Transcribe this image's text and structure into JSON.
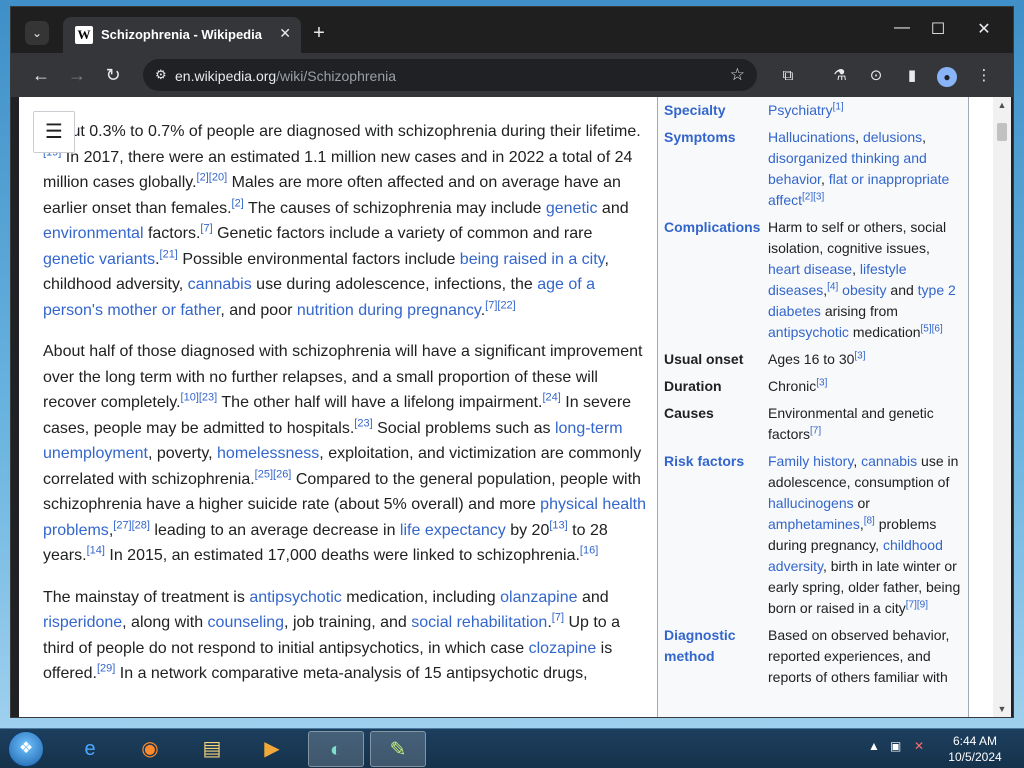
{
  "browser": {
    "tab_title": "Schizophrenia - Wikipedia",
    "favicon": "W",
    "url_host": "en.wikipedia.org",
    "url_path": "/wiki/Schizophrenia"
  },
  "article": {
    "p1": [
      {
        "t": "About 0.3% to 0.7% of people are diagnosed with schizophrenia during their lifetime."
      },
      {
        "s": "[19]"
      },
      {
        "t": " In 2017, there were an estimated 1.1 million new cases and in 2022 a total of 24 million cases globally."
      },
      {
        "s": "[2][20]"
      },
      {
        "t": " Males are more often affected and on average have an earlier onset than females."
      },
      {
        "s": "[2]"
      },
      {
        "t": " The causes of schizophrenia may include "
      },
      {
        "a": "genetic"
      },
      {
        "t": " and "
      },
      {
        "a": "environmental"
      },
      {
        "t": " factors."
      },
      {
        "s": "[7]"
      },
      {
        "t": " Genetic factors include a variety of common and rare "
      },
      {
        "a": "genetic variants"
      },
      {
        "t": "."
      },
      {
        "s": "[21]"
      },
      {
        "t": " Possible environmental factors include "
      },
      {
        "a": "being raised in a city"
      },
      {
        "t": ", childhood adversity, "
      },
      {
        "a": "cannabis"
      },
      {
        "t": " use during adolescence, infections, the "
      },
      {
        "a": "age of a person's mother or father"
      },
      {
        "t": ", and poor "
      },
      {
        "a": "nutrition during pregnancy"
      },
      {
        "t": "."
      },
      {
        "s": "[7][22]"
      }
    ],
    "p2": [
      {
        "t": "About half of those diagnosed with schizophrenia will have a significant improvement over the long term with no further relapses, and a small proportion of these will recover completely."
      },
      {
        "s": "[10][23]"
      },
      {
        "t": " The other half will have a lifelong impairment."
      },
      {
        "s": "[24]"
      },
      {
        "t": " In severe cases, people may be admitted to hospitals."
      },
      {
        "s": "[23]"
      },
      {
        "t": " Social problems such as "
      },
      {
        "a": "long-term unemployment"
      },
      {
        "t": ", poverty, "
      },
      {
        "a": "homelessness"
      },
      {
        "t": ", exploitation, and victimization are commonly correlated with schizophrenia."
      },
      {
        "s": "[25][26]"
      },
      {
        "t": " Compared to the general population, people with schizophrenia have a higher suicide rate (about 5% overall) and more "
      },
      {
        "a": "physical health problems"
      },
      {
        "t": ","
      },
      {
        "s": "[27][28]"
      },
      {
        "t": " leading to an average decrease in "
      },
      {
        "a": "life expectancy"
      },
      {
        "t": " by 20"
      },
      {
        "s": "[13]"
      },
      {
        "t": " to 28 years."
      },
      {
        "s": "[14]"
      },
      {
        "t": " In 2015, an estimated 17,000 deaths were linked to schizophrenia."
      },
      {
        "s": "[16]"
      }
    ],
    "p3": [
      {
        "t": "The mainstay of treatment is "
      },
      {
        "a": "antipsychotic"
      },
      {
        "t": " medication, including "
      },
      {
        "a": "olanzapine"
      },
      {
        "t": " and "
      },
      {
        "a": "risperidone"
      },
      {
        "t": ", along with "
      },
      {
        "a": "counseling"
      },
      {
        "t": ", job training, and "
      },
      {
        "a": "social rehabilitation"
      },
      {
        "t": "."
      },
      {
        "s": "[7]"
      },
      {
        "t": " Up to a third of people do not respond to initial antipsychotics, in which case "
      },
      {
        "a": "clozapine"
      },
      {
        "t": " is offered."
      },
      {
        "s": "[29]"
      },
      {
        "t": " In a network comparative meta-analysis of 15 antipsychotic drugs,"
      }
    ]
  },
  "infobox": [
    {
      "label": "Specialty",
      "label_link": true,
      "value": [
        {
          "a": "Psychiatry"
        },
        {
          "s": "[1]"
        }
      ]
    },
    {
      "label": "Symptoms",
      "label_link": true,
      "value": [
        {
          "a": "Hallucinations"
        },
        {
          "t": ", "
        },
        {
          "a": "delusions"
        },
        {
          "t": ", "
        },
        {
          "a": "disorganized thinking and behavior"
        },
        {
          "t": ", "
        },
        {
          "a": "flat or inappropriate affect"
        },
        {
          "s": "[2][3]"
        }
      ]
    },
    {
      "label": "Complications",
      "label_link": true,
      "value": [
        {
          "t": "Harm to self or others, social isolation, cognitive issues, "
        },
        {
          "a": "heart disease"
        },
        {
          "t": ", "
        },
        {
          "a": "lifestyle diseases"
        },
        {
          "t": ","
        },
        {
          "s": "[4]"
        },
        {
          "t": " "
        },
        {
          "a": "obesity"
        },
        {
          "t": " and "
        },
        {
          "a": "type 2 diabetes"
        },
        {
          "t": " arising from "
        },
        {
          "a": "antipsychotic"
        },
        {
          "t": " medication"
        },
        {
          "s": "[5][6]"
        }
      ]
    },
    {
      "label": "Usual onset",
      "label_link": false,
      "value": [
        {
          "t": "Ages 16 to 30"
        },
        {
          "s": "[3]"
        }
      ]
    },
    {
      "label": "Duration",
      "label_link": false,
      "value": [
        {
          "t": "Chronic"
        },
        {
          "s": "[3]"
        }
      ]
    },
    {
      "label": "Causes",
      "label_link": false,
      "value": [
        {
          "t": "Environmental and genetic factors"
        },
        {
          "s": "[7]"
        }
      ]
    },
    {
      "label": "Risk factors",
      "label_link": true,
      "value": [
        {
          "a": "Family history"
        },
        {
          "t": ", "
        },
        {
          "a": "cannabis"
        },
        {
          "t": " use in adolescence, consumption of "
        },
        {
          "a": "hallucinogens"
        },
        {
          "t": " or "
        },
        {
          "a": "amphetamines"
        },
        {
          "t": ","
        },
        {
          "s": "[8]"
        },
        {
          "t": " problems during pregnancy, "
        },
        {
          "a": "childhood adversity"
        },
        {
          "t": ", birth in late winter or early spring, older father, being born or raised in a city"
        },
        {
          "s": "[7][9]"
        }
      ]
    },
    {
      "label": "Diagnostic method",
      "label_link": true,
      "value": [
        {
          "t": "Based on observed behavior, reported experiences, and reports of others familiar with"
        }
      ]
    }
  ],
  "taskbar": {
    "time": "6:44 AM",
    "date": "10/5/2024"
  },
  "icons": {
    "tab_search": "chevron-down-icon",
    "close_tab": "close-icon",
    "new_tab": "plus-icon",
    "back": "arrow-left-icon",
    "forward": "arrow-right-icon",
    "reload": "reload-icon",
    "bookmark": "star-icon",
    "toc": "list-icon"
  }
}
